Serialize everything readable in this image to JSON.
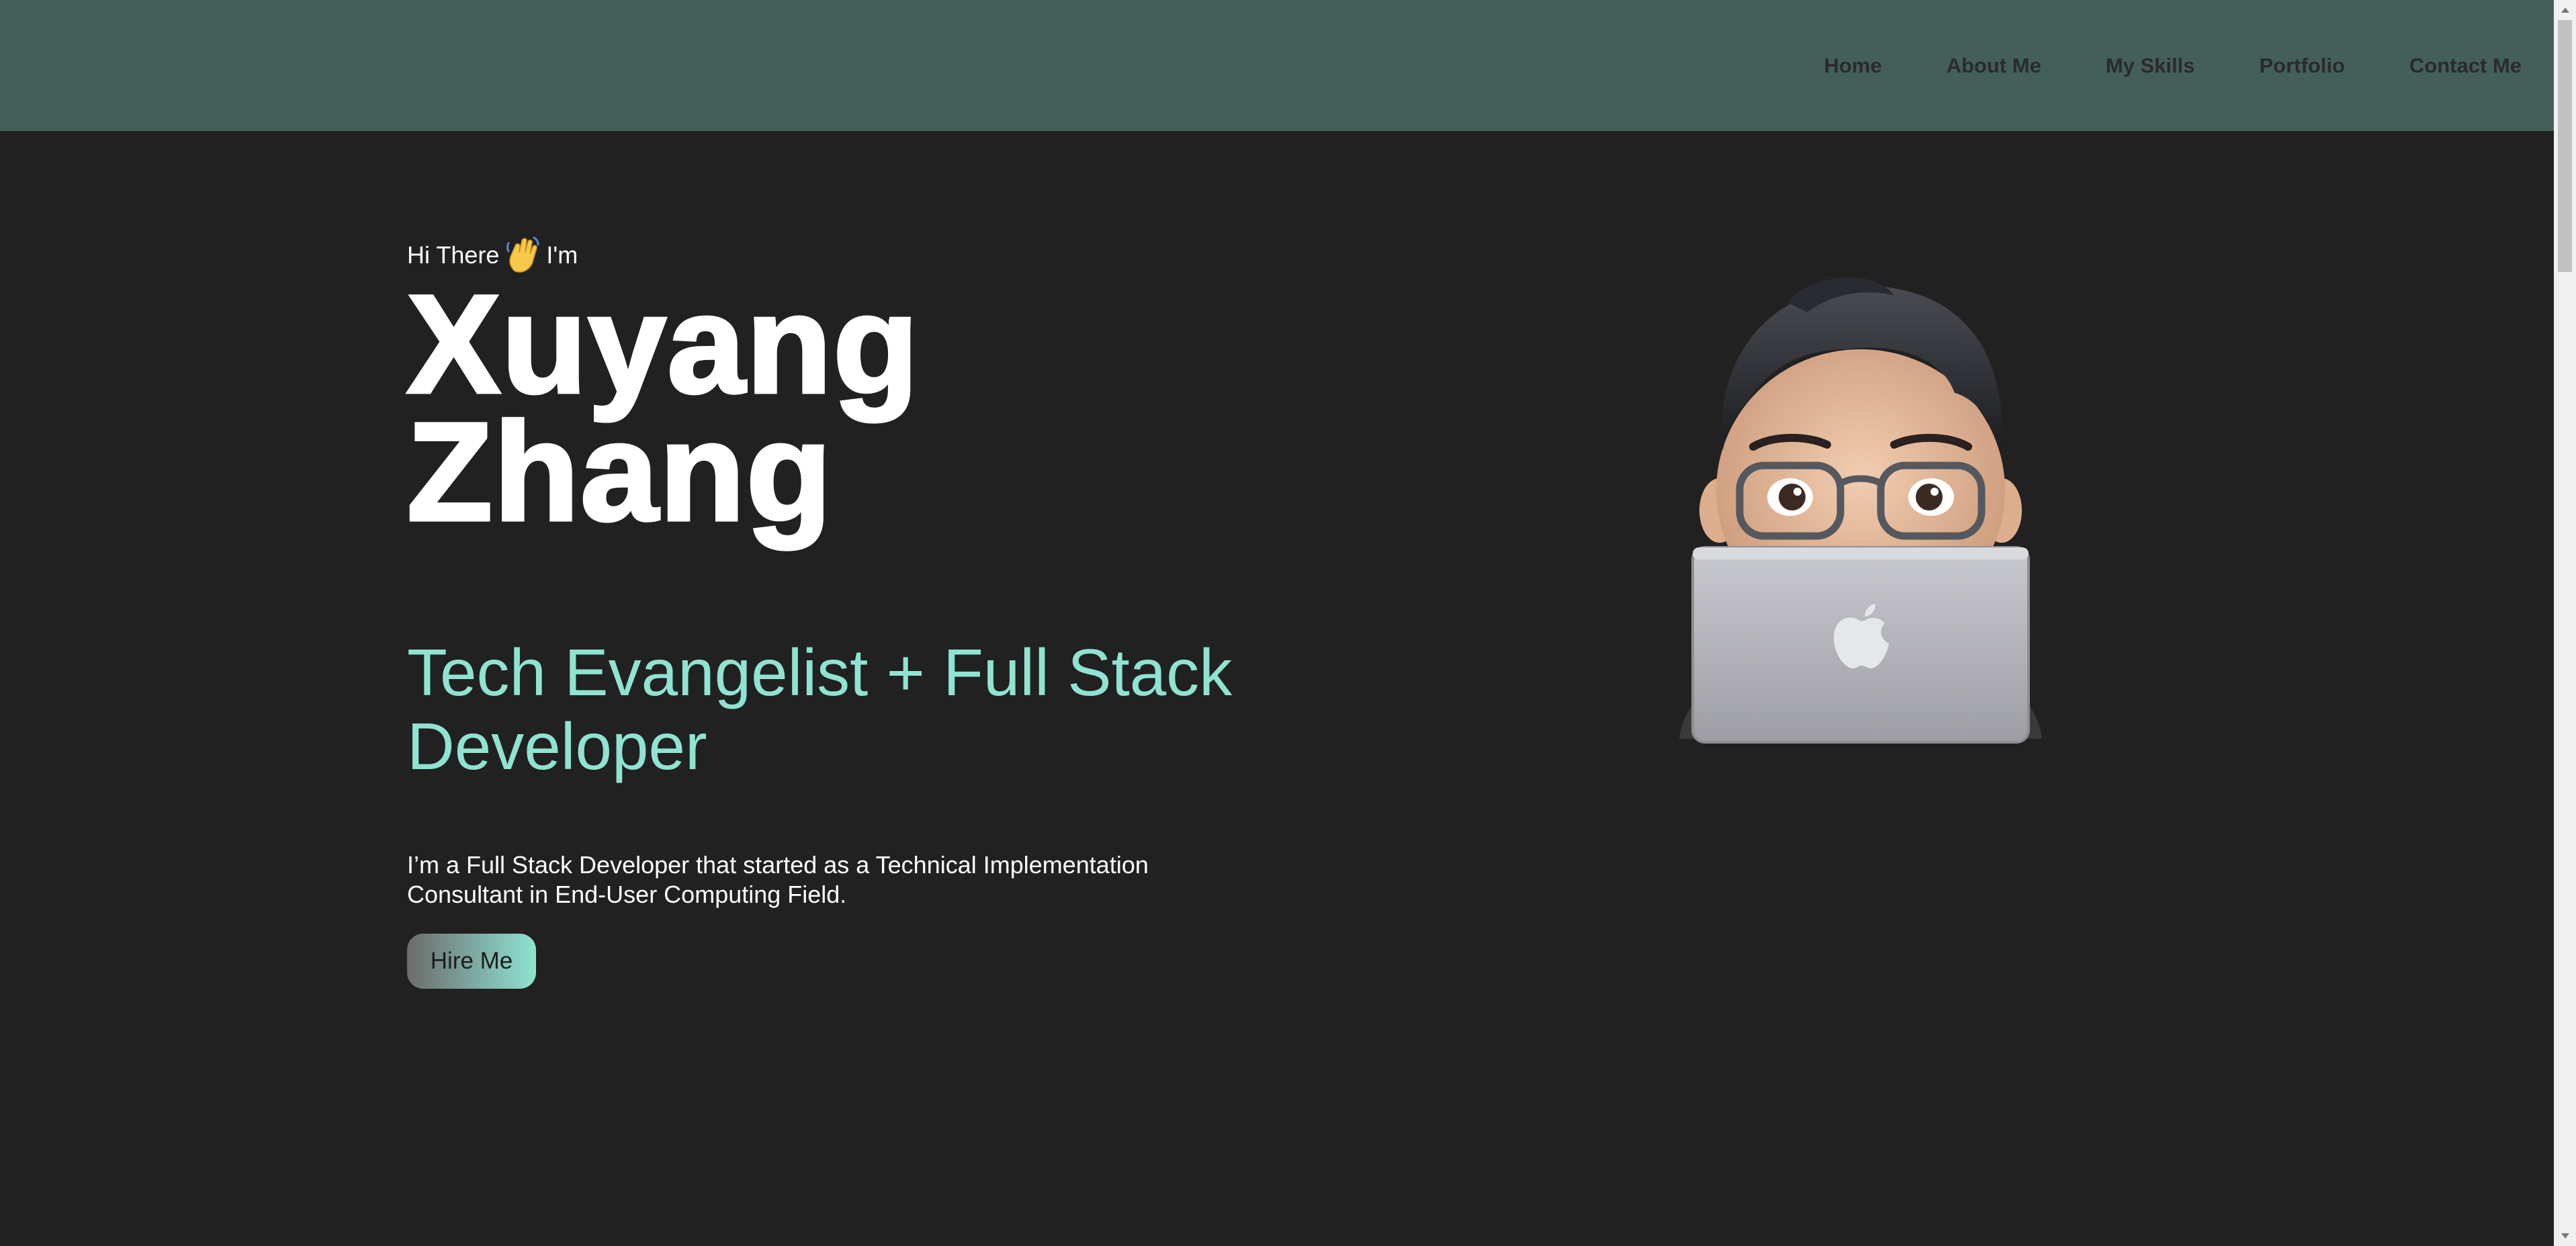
{
  "nav": {
    "links": [
      {
        "label": "Home"
      },
      {
        "label": "About Me"
      },
      {
        "label": "My Skills"
      },
      {
        "label": "Portfolio"
      },
      {
        "label": "Contact Me"
      }
    ]
  },
  "hero": {
    "greeting_before": "Hi There",
    "greeting_after": "I'm",
    "wave_emoji": "waving-hand-icon",
    "first_name": "Xuyang",
    "last_name": "Zhang",
    "tagline": "Tech Evangelist + Full Stack Developer",
    "bio": "I’m a Full Stack Developer that started as a Technical Implementation Consultant in End-User Computing Field.",
    "cta_label": "Hire Me"
  },
  "colors": {
    "nav_bg": "#445f5a",
    "page_bg": "#212121",
    "accent": "#8fe3d2",
    "text": "#ffffff",
    "nav_text": "#2b2b2b"
  },
  "avatar": {
    "icon": "memoji-laptop-avatar"
  }
}
